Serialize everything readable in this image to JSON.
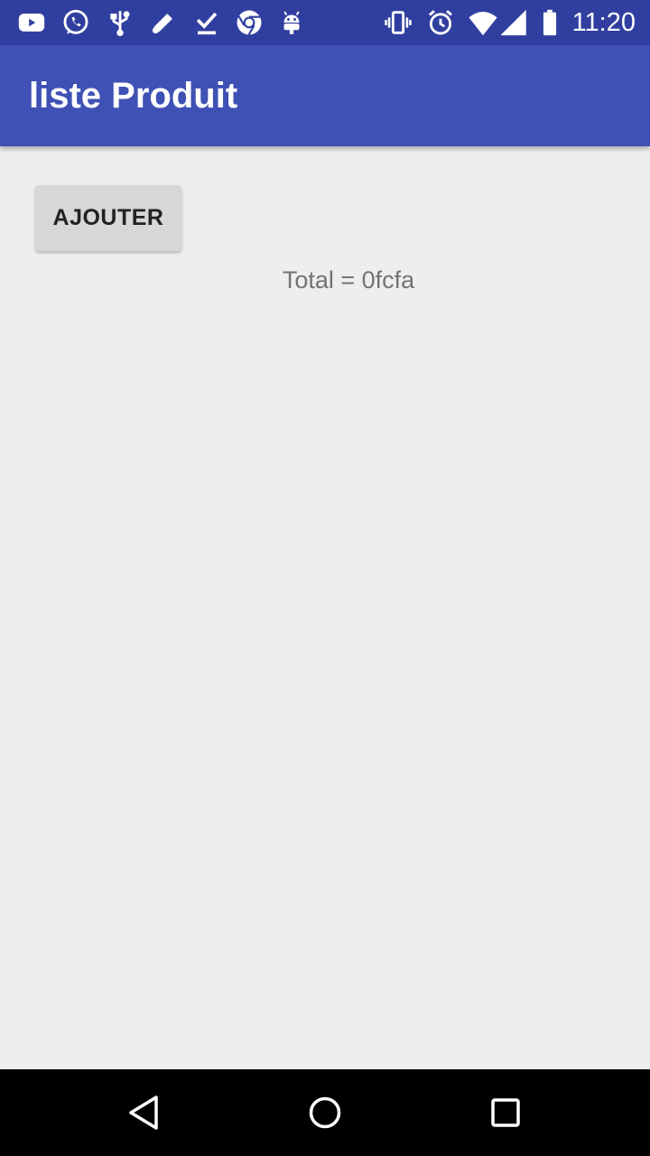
{
  "status_bar": {
    "time": "11:20",
    "icons_left": [
      "youtube-icon",
      "whatsapp-icon",
      "usb-icon",
      "edit-icon",
      "download-done-icon",
      "chrome-icon",
      "android-icon"
    ],
    "icons_right": [
      "vibrate-icon",
      "alarm-icon",
      "wifi-icon",
      "signal-icon",
      "battery-icon"
    ]
  },
  "app_bar": {
    "title": "liste Produit"
  },
  "main": {
    "add_button_label": "AJOUTER",
    "total_text": "Total = 0fcfa"
  },
  "nav_bar": {
    "icons": [
      "back-icon",
      "home-icon",
      "recents-icon"
    ]
  },
  "colors": {
    "status_bar": "#303f9f",
    "app_bar": "#3f51b5",
    "background": "#eeeeee",
    "button": "#d6d7d7",
    "total_text": "#737373",
    "nav_bar": "#000000"
  }
}
